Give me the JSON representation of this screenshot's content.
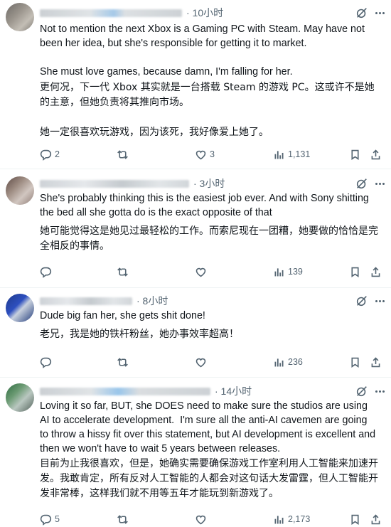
{
  "posts": [
    {
      "time": "· 10小时",
      "text_en": "Not to mention the next Xbox is a Gaming PC with Steam. May have not been her idea, but she's responsible for getting it to market.\n\nShe must love games, because damn, I'm falling for her.",
      "text_zh": "更何况，下一代 Xbox 其实就是一台搭载 Steam 的游戏 PC。这或许不是她的主意，但她负责将其推向市场。\n\n她一定很喜欢玩游戏，因为该死，我好像爱上她了。",
      "replies": "2",
      "reposts": "",
      "likes": "3",
      "views": "1,131"
    },
    {
      "time": "· 3小时",
      "text_en": "She's probably thinking this is the easiest job ever. And with Sony shitting the bed all she gotta do is the exact opposite of that",
      "text_zh": "她可能觉得这是她见过最轻松的工作。而索尼现在一团糟，她要做的恰恰是完全相反的事情。",
      "replies": "",
      "reposts": "",
      "likes": "",
      "views": "139"
    },
    {
      "time": "· 8小时",
      "text_en": "Dude big fan her, she gets shit done!",
      "text_zh": "老兄，我是她的铁杆粉丝，她办事效率超高！",
      "replies": "",
      "reposts": "",
      "likes": "",
      "views": "236"
    },
    {
      "time": "· 14小时",
      "text_en": "Loving it so far, BUT, she DOES need to make sure the studios are using AI to accelerate development.  I'm sure all the anti-AI cavemen are going to throw a hissy fit over this statement, but AI development is excellent and then we won't have to wait 5 years between releases.",
      "text_zh": "目前为止我很喜欢，但是，她确实需要确保游戏工作室利用人工智能来加速开发。我敢肯定，所有反对人工智能的人都会对这句话大发雷霆，但人工智能开发非常棒，这样我们就不用等五年才能玩到新游戏了。",
      "replies": "5",
      "reposts": "",
      "likes": "",
      "views": "2,173"
    }
  ],
  "icons": {
    "reply": "reply-icon",
    "repost": "repost-icon",
    "like": "like-icon",
    "views": "views-icon",
    "bookmark": "bookmark-icon",
    "share": "share-icon",
    "grok": "grok-icon",
    "more": "more-icon"
  },
  "colors": {
    "text": "#0f1419",
    "secondary": "#536471",
    "divider": "#eff3f4"
  }
}
